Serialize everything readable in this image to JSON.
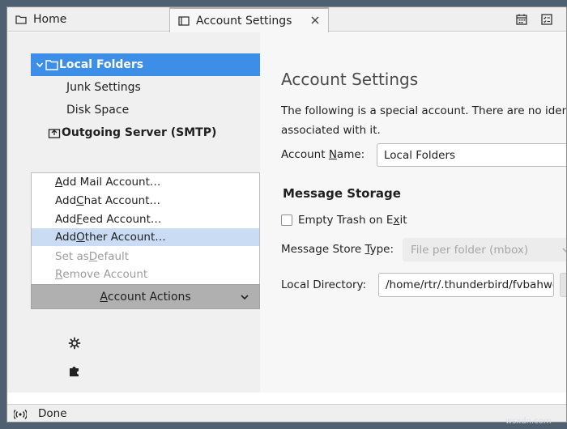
{
  "tabs": {
    "home_label": "Home",
    "account_label": "Account Settings"
  },
  "tree": {
    "local_folders": "Local Folders",
    "junk_settings": "Junk Settings",
    "disk_space": "Disk Space",
    "outgoing_server": "Outgoing Server (SMTP)"
  },
  "menu": {
    "items": [
      {
        "pre": "",
        "key": "A",
        "post": "dd Mail Account…"
      },
      {
        "pre": "Add ",
        "key": "C",
        "post": "hat Account…"
      },
      {
        "pre": "Add ",
        "key": "F",
        "post": "eed Account…"
      },
      {
        "pre": "Add ",
        "key": "O",
        "post": "ther Account…"
      },
      {
        "pre": "Set as ",
        "key": "D",
        "post": "efault"
      },
      {
        "pre": "",
        "key": "R",
        "post": "emove Account"
      }
    ],
    "actions": {
      "pre": "",
      "key": "A",
      "post": "ccount Actions"
    }
  },
  "panel": {
    "heading": "Account Settings",
    "desc_line1": "The following is a special account. There are no identities",
    "desc_line2": "associated with it.",
    "account_name_label": {
      "pre": "Account ",
      "key": "N",
      "post": "ame:"
    },
    "account_name_value": "Local Folders",
    "storage_heading": "Message Storage",
    "empty_trash": {
      "pre": "Empty Trash on E",
      "key": "x",
      "post": "it"
    },
    "store_type_label": {
      "pre": "Message Store ",
      "key": "T",
      "post": "ype:"
    },
    "store_type_value": "File per folder (mbox)",
    "local_dir_label": "Local Directory:",
    "local_dir_value": "/home/rtr/.thunderbird/fvbahwqa.default/Mail/Local Folders"
  },
  "status": {
    "text": "Done"
  },
  "watermark": "wsxdn.com",
  "colors": {
    "selection": "#3d8ee6",
    "menu_hover": "#c9dcf3",
    "actions_bg": "#b0b0b0"
  }
}
